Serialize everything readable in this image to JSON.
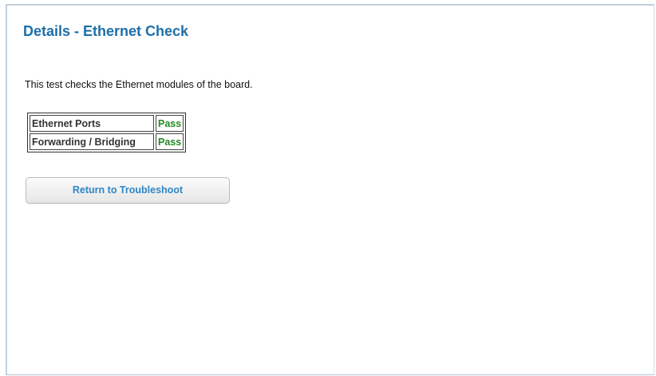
{
  "page": {
    "title": "Details - Ethernet Check",
    "description": "This test checks the Ethernet modules of the board."
  },
  "results": [
    {
      "name": "Ethernet Ports",
      "status": "Pass"
    },
    {
      "name": "Forwarding / Bridging",
      "status": "Pass"
    }
  ],
  "actions": {
    "return_label": "Return to Troubleshoot"
  },
  "colors": {
    "title": "#1d6fa9",
    "pass": "#228b22",
    "button_text": "#2e86c4"
  }
}
